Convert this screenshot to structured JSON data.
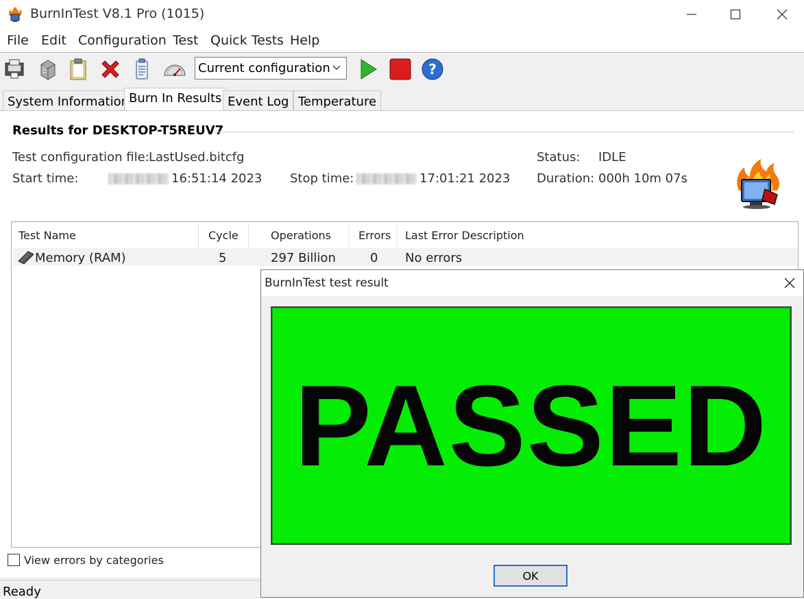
{
  "window": {
    "title": "BurnInTest V8.1 Pro (1015)"
  },
  "menu": [
    "File",
    "Edit",
    "Configuration",
    "Test",
    "Quick Tests",
    "Help"
  ],
  "toolbar": {
    "config_value": "Current configuration",
    "icons": [
      "save-report-icon",
      "copy-report-icon",
      "clipboard-icon",
      "clear-results-icon",
      "notepad-config-icon",
      "gauge-icon",
      "play-icon",
      "stop-icon",
      "help-icon"
    ]
  },
  "tabs": [
    "System Information",
    "Burn In Results",
    "Event Log",
    "Temperature"
  ],
  "results": {
    "title": "Results for DESKTOP-T5REUV7",
    "config_label": "Test configuration file:",
    "config_file": "LastUsed.bitcfg",
    "start_label": "Start time:",
    "start_value": "16:51:14 2023",
    "stop_label": "Stop time:",
    "stop_value": "17:01:21 2023",
    "status_label": "Status:",
    "status_value": "IDLE",
    "duration_label": "Duration:",
    "duration_value": "000h 10m 07s"
  },
  "table": {
    "headers": [
      "Test Name",
      "Cycle",
      "Operations",
      "Errors",
      "Last Error Description"
    ],
    "rows": [
      {
        "name": "Memory (RAM)",
        "cycle": "5",
        "operations": "297 Billion",
        "errors": "0",
        "description": "No errors"
      }
    ]
  },
  "view_errors_label": "View errors by categories",
  "status_bar": "Ready",
  "dialog": {
    "title": "BurnInTest test result",
    "result": "PASSED",
    "ok_label": "OK"
  },
  "colors": {
    "passed_green": "#05ed05",
    "play_green": "#2fb52f",
    "stop_red": "#d81e1e",
    "help_blue": "#2a6fd0"
  }
}
